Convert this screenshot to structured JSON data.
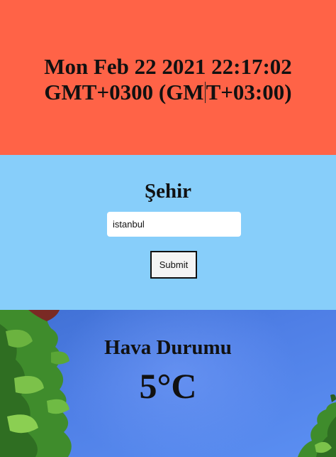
{
  "datetime": {
    "line1": "Mon Feb 22 2021 22:17:02",
    "line2_before_cursor": "GMT+0300 (GM",
    "line2_after_cursor": "T+03:00)"
  },
  "city": {
    "title": "Şehir",
    "input_value": "istanbul",
    "submit_label": "Submit"
  },
  "weather": {
    "title": "Hava Durumu",
    "temperature": "5°C"
  },
  "colors": {
    "time_background": "#ff6347",
    "city_background": "#87cefa",
    "sky": "#4f7fe6",
    "foliage": "#3d8a2a"
  }
}
